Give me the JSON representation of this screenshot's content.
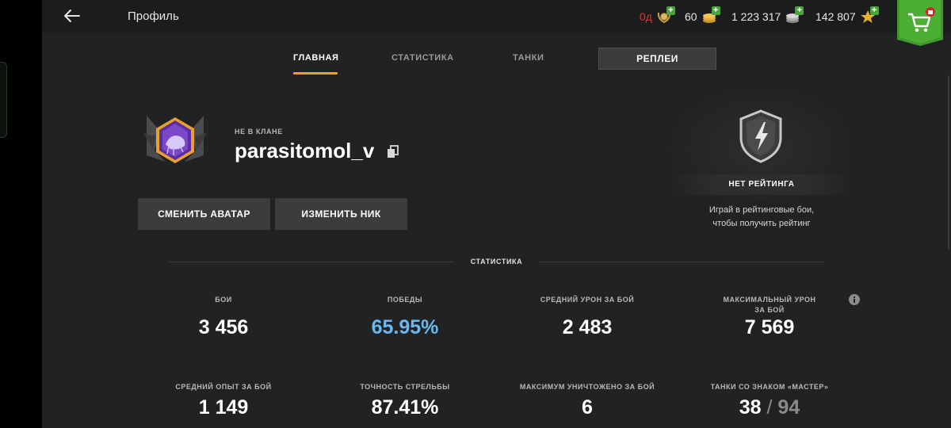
{
  "header": {
    "title": "Профиль",
    "resources": [
      {
        "name": "premium-days",
        "value": "0д",
        "icon": "laurel-medal-icon"
      },
      {
        "name": "gold",
        "value": "60",
        "icon": "gold-coins-icon"
      },
      {
        "name": "credits",
        "value": "1 223 317",
        "icon": "silver-coins-icon"
      },
      {
        "name": "free-xp",
        "value": "142 807",
        "icon": "star-icon"
      }
    ],
    "shop_icon": "cart-icon"
  },
  "tabs": [
    {
      "label": "ГЛАВНАЯ",
      "active": true
    },
    {
      "label": "СТАТИСТИКА",
      "active": false
    },
    {
      "label": "ТАНКИ",
      "active": false
    },
    {
      "label": "РЕПЛЕИ",
      "active": false
    }
  ],
  "profile": {
    "clan": "НЕ В КЛАНЕ",
    "nickname": "parasitomol_v",
    "change_avatar": "СМЕНИТЬ АВАТАР",
    "change_nick": "ИЗМЕНИТЬ НИК"
  },
  "rating": {
    "status": "НЕТ РЕЙТИНГА",
    "hint_line1": "Играй в рейтинговые бои,",
    "hint_line2": "чтобы получить рейтинг"
  },
  "stats": {
    "header": "СТАТИСТИКА",
    "items": [
      {
        "label": "БОИ",
        "value": "3 456"
      },
      {
        "label": "ПОБЕДЫ",
        "value": "65.95%"
      },
      {
        "label": "СРЕДНИЙ УРОН ЗА БОЙ",
        "value": "2 483"
      },
      {
        "label": "МАКСИМАЛЬНЫЙ УРОН",
        "label2": "ЗА БОЙ",
        "value": "7 569"
      },
      {
        "label": "СРЕДНИЙ ОПЫТ ЗА БОЙ",
        "value": "1 149"
      },
      {
        "label": "ТОЧНОСТЬ СТРЕЛЬБЫ",
        "value": "87.41%"
      },
      {
        "label": "МАКСИМУМ УНИЧТОЖЕНО ЗА БОЙ",
        "value": "6"
      },
      {
        "label": "ТАНКИ СО ЗНАКОМ «МАСТЕР»",
        "value": "38",
        "value_sep": "/",
        "value_total": "94"
      }
    ]
  },
  "colors": {
    "accent": "#f0a020",
    "win_rate": "#6ab8ee",
    "premium_red": "#e53030",
    "plus_green": "#4aa33a"
  }
}
